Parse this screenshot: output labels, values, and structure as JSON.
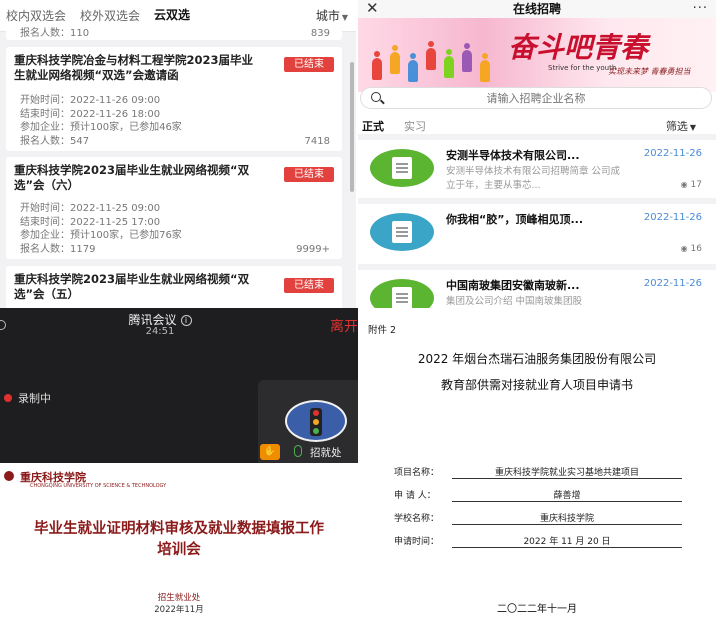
{
  "jobfair": {
    "tabs": [
      "校内双选会",
      "校外双选会",
      "云双选"
    ],
    "active_tab": 2,
    "city_label": "城市",
    "partial_card": {
      "signup_label": "报名人数：110",
      "signup_count": "839"
    },
    "cards": [
      {
        "title": "重庆科技学院冶金与材料工程学院2023届毕业生就业网络视频“双选”会邀请函",
        "status": "已结束",
        "start": "开始时间：2022-11-26 09:00",
        "end": "结束时间：2022-11-26 18:00",
        "companies": "参加企业：预计100家，已参加46家",
        "signup": "报名人数：547",
        "count": "7418"
      },
      {
        "title": "重庆科技学院2023届毕业生就业网络视频“双选”会（六）",
        "status": "已结束",
        "start": "开始时间：2022-11-25 09:00",
        "end": "结束时间：2022-11-25 17:00",
        "companies": "参加企业：预计100家，已参加76家",
        "signup": "报名人数：1179",
        "count": "9999+"
      },
      {
        "title": "重庆科技学院2023届毕业生就业网络视频“双选”会（五）",
        "status": "已结束"
      }
    ]
  },
  "recruit": {
    "close_glyph": "✕",
    "title": "在线招聘",
    "more_glyph": "···",
    "banner": {
      "slogan": "奋斗吧青春",
      "slogan_en": "Strive for the youth",
      "slogan_cn": "实现未来梦 青春勇担当"
    },
    "search_placeholder": "请输入招聘企业名称",
    "subtabs": {
      "formal": "正式",
      "intern": "实习",
      "filter": "筛选"
    },
    "jobs": [
      {
        "name": "安测半导体技术有限公司...",
        "date": "2022-11-26",
        "desc": "安测半导体技术有限公司招聘简章 公司成立于年，主要从事芯...",
        "views": "17",
        "logo_color": "#5cb531"
      },
      {
        "name": "你我相“胶”，顶峰相见顶...",
        "date": "2022-11-26",
        "desc": "",
        "views": "16",
        "logo_color": "#3aa5c6"
      },
      {
        "name": "中国南玻集团安徽南玻新...",
        "date": "2022-11-26",
        "desc": "集团及公司介绍 中国南玻集团股",
        "views": "",
        "logo_color": "#5cb531"
      }
    ]
  },
  "meeting": {
    "app_title": "腾讯会议",
    "info_glyph": "i",
    "elapsed": "24:51",
    "leave": "离开",
    "recording": "录制中",
    "participant": "招就处",
    "slide": {
      "school": "重庆科技学院",
      "school_en": "CHONGQING UNIVERSITY OF SCIENCE & TECHNOLOGY",
      "title_line1": "毕业生就业证明材料审核及就业数据填报工作",
      "title_line2": "培训会",
      "dept": "招生就业处",
      "date": "2022年11月"
    }
  },
  "document": {
    "attachment": "附件 2",
    "heading1": "2022 年烟台杰瑞石油服务集团股份有限公司",
    "heading2": "教育部供需对接就业育人项目申请书",
    "fields": [
      {
        "label": "项目名称：",
        "value": "重庆科技学院就业实习基地共建项目"
      },
      {
        "label": "申  请  人：",
        "value": "薛善增"
      },
      {
        "label": "学校名称：",
        "value": "重庆科技学院"
      },
      {
        "label": "申请时间：",
        "value": "2022 年 11 月 20 日"
      }
    ],
    "bottom_date": "二〇二二年十一月"
  }
}
